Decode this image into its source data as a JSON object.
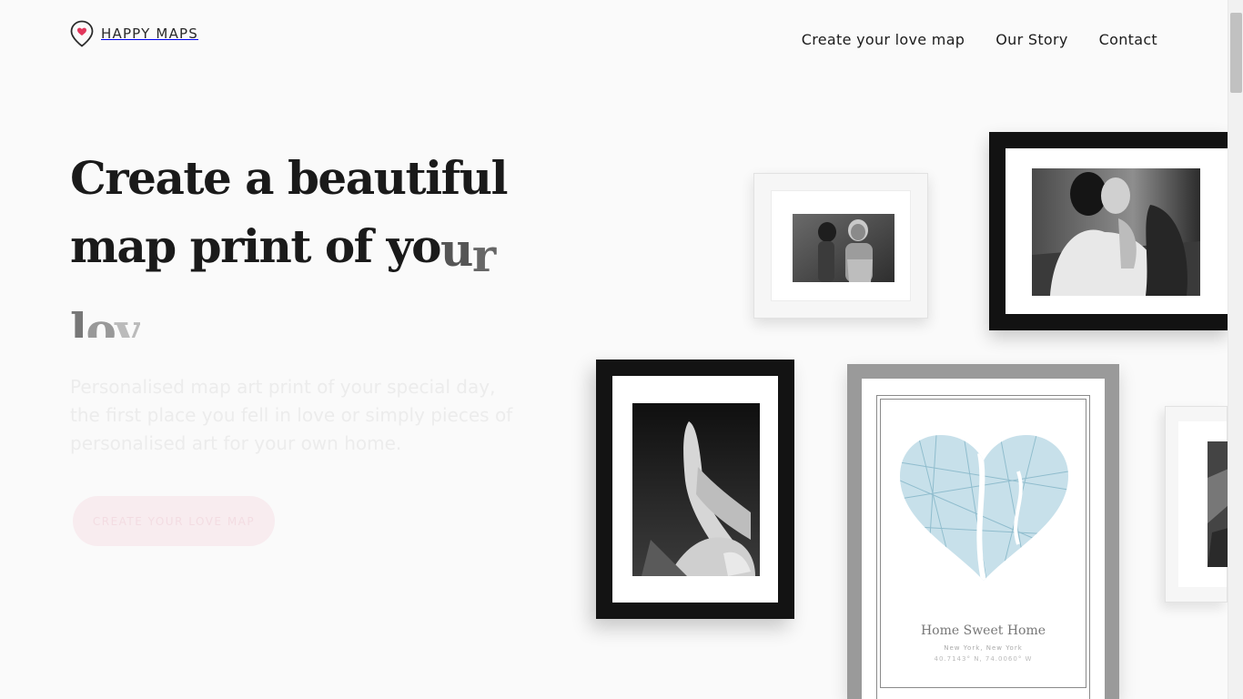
{
  "brand": {
    "name": "HAPPY MAPS",
    "accent": "#e2375c"
  },
  "nav": {
    "items": [
      "Create your love map",
      "Our Story",
      "Contact"
    ]
  },
  "hero": {
    "line1": "Create a beautiful",
    "line2_main": "map print of ",
    "line2_you": "yo",
    "line2_u": "u",
    "line2_r": "r",
    "line3_l": "l",
    "line3_o": "o",
    "line3_v": "v",
    "subtitle": "Personalised map art print of your special day, the first place you fell in love or simply pieces of personalised art for your own home.",
    "cta": "CREATE YOUR LOVE MAP"
  },
  "gallery": {
    "print_title": "Home Sweet Home",
    "print_subtitle": "New York, New York",
    "print_coords": "40.7143° N, 74.0060° W"
  }
}
